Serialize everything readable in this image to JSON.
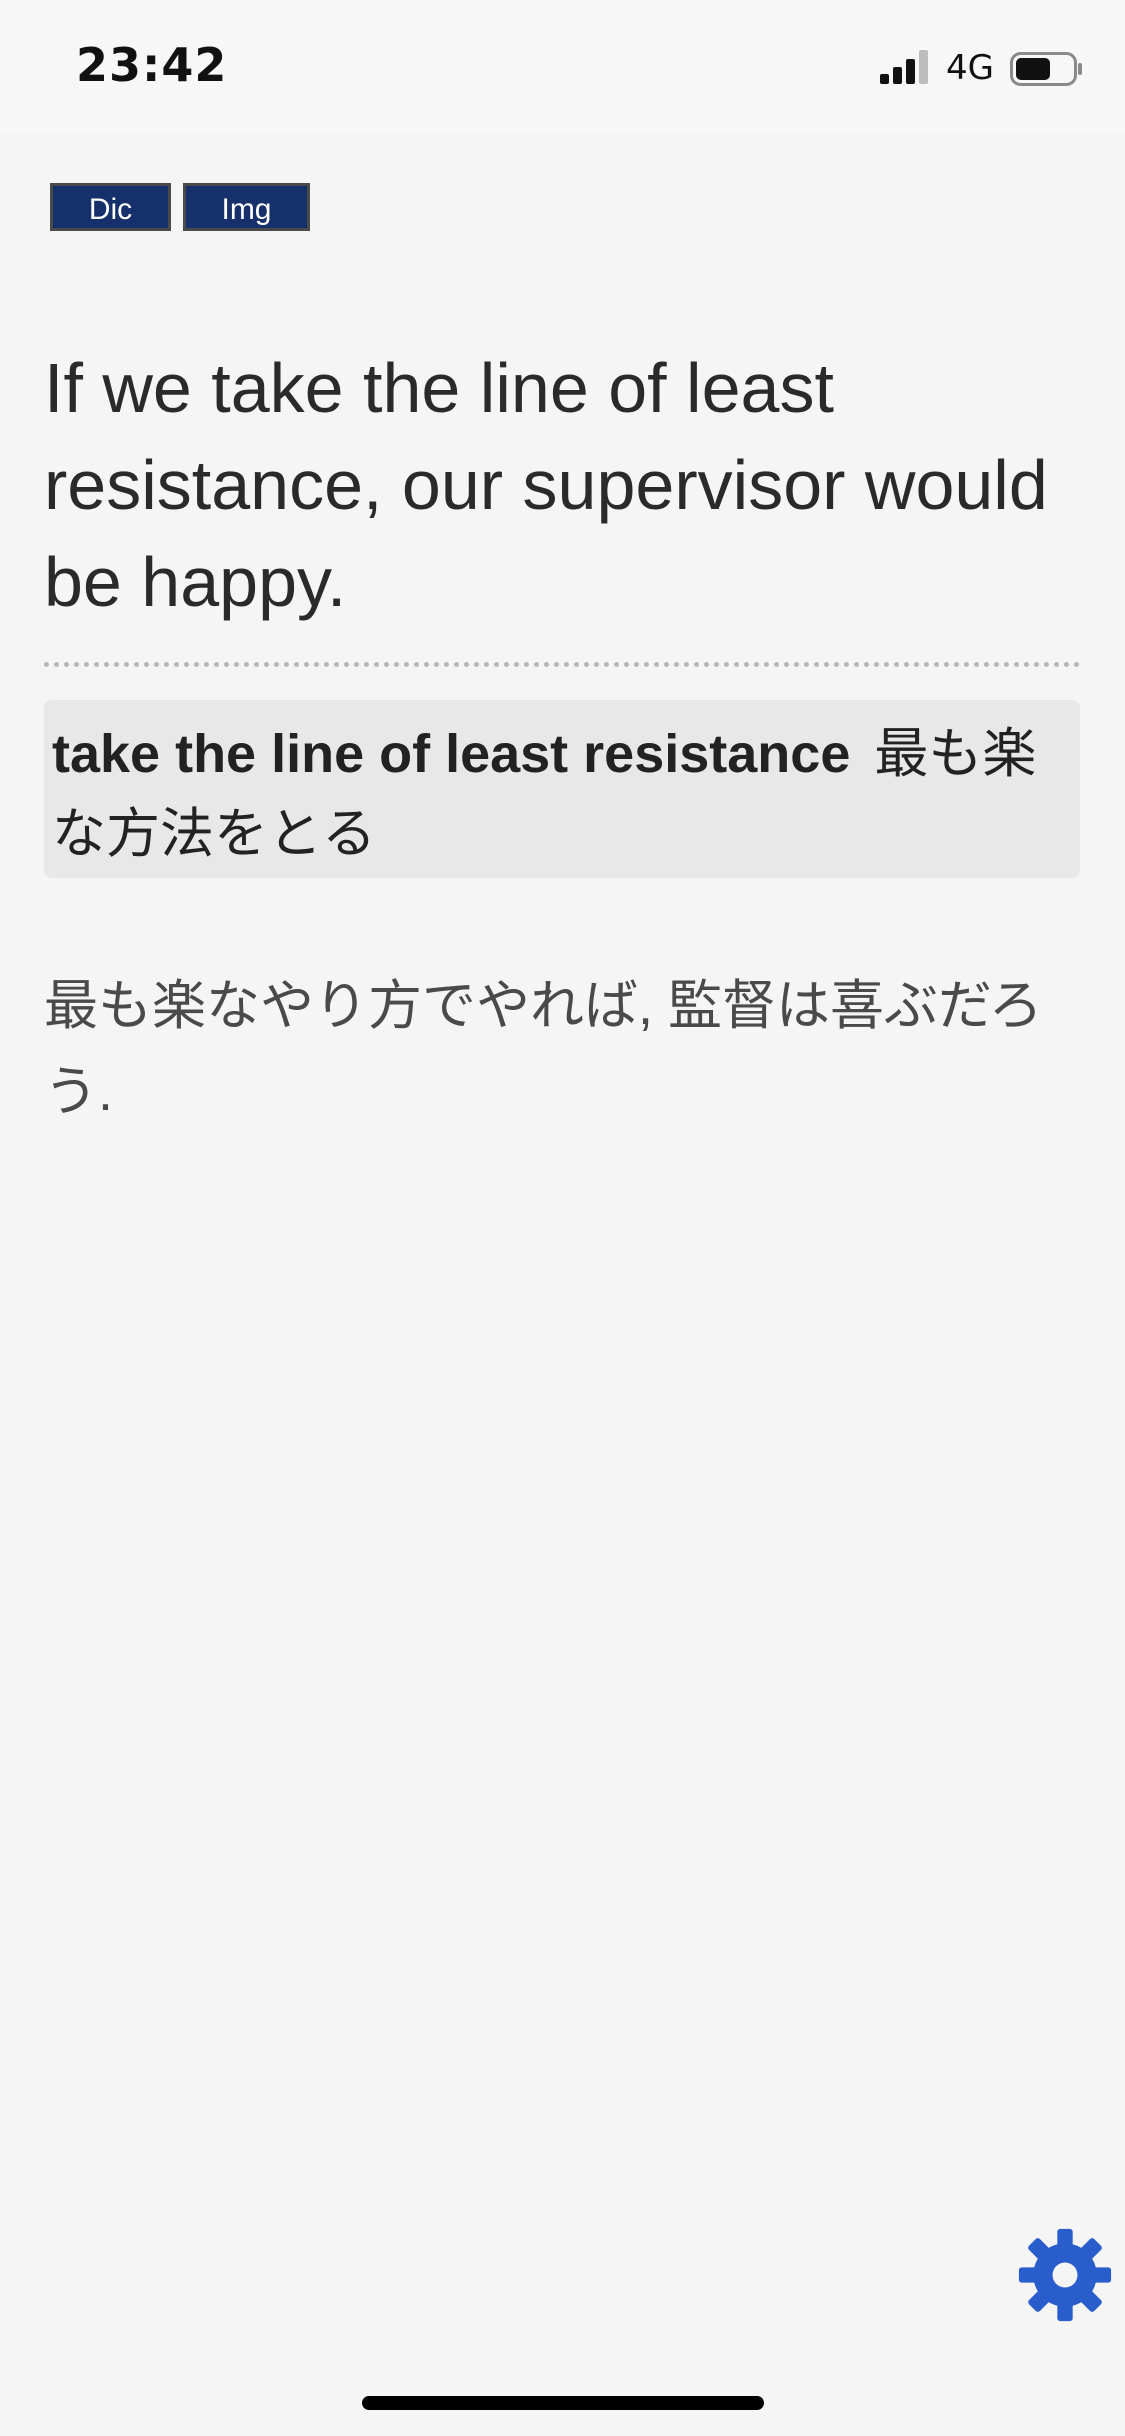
{
  "status_bar": {
    "time": "23:42",
    "network": "4G",
    "icons": [
      "signal-bars-icon",
      "battery-icon"
    ]
  },
  "toolbar": {
    "dic_label": "Dic",
    "img_label": "Img",
    "button_color": "#15306a"
  },
  "sentence": {
    "english": "If we take the line of least resistance, our supervisor would be happy."
  },
  "definition": {
    "term": "take the line of least resistance",
    "meaning": "最も楽な方法をとる"
  },
  "translation": {
    "text": "最も楽なやり方でやれば, 監督は喜ぶだろう."
  },
  "settings": {
    "icon": "gear-icon",
    "color": "#2a5dcc"
  }
}
